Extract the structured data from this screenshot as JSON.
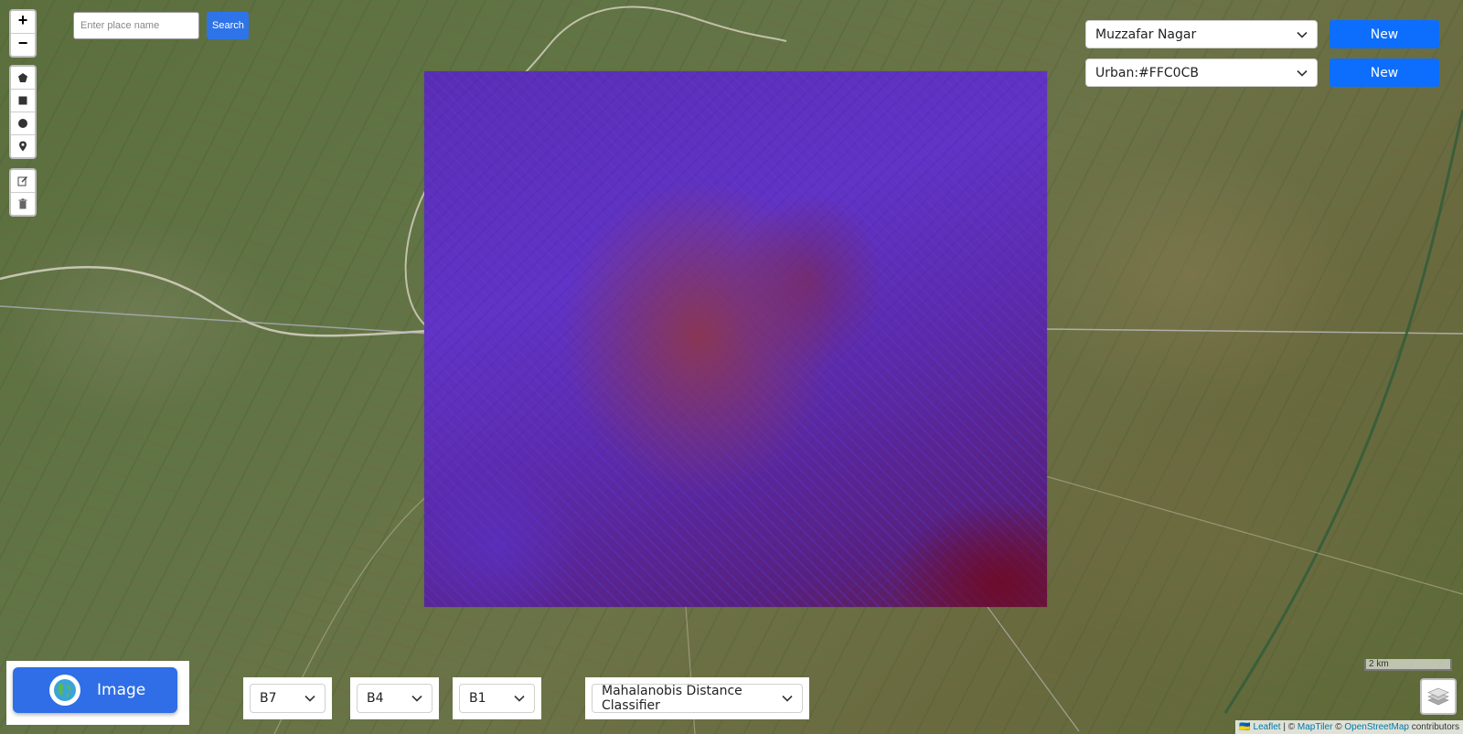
{
  "search": {
    "placeholder": "Enter place name",
    "button_label": "Search"
  },
  "zoom": {
    "in_label": "+",
    "out_label": "−"
  },
  "draw_tools": [
    "polygon-icon",
    "rectangle-icon",
    "circle-icon",
    "marker-icon"
  ],
  "edit_tools": [
    "edit-icon",
    "trash-icon"
  ],
  "top_right": {
    "region_select": {
      "value": "Muzzafar Nagar"
    },
    "region_new_label": "New",
    "class_select": {
      "value": "Urban:#FFC0CB"
    },
    "class_new_label": "New"
  },
  "bottom": {
    "image_button_label": "Image",
    "band_selects": [
      {
        "value": "B7"
      },
      {
        "value": "B4"
      },
      {
        "value": "B1"
      }
    ],
    "classifier_select": {
      "value": "Mahalanobis Distance Classifier"
    }
  },
  "scale": {
    "label": "2 km"
  },
  "attribution": {
    "flag": "🇺🇦",
    "leaflet": "Leaflet",
    "sep1": " | © ",
    "maptiler": "MapTiler",
    "sep2": " © ",
    "osm": "OpenStreetMap",
    "suffix": " contributors"
  },
  "colors": {
    "accent": "#0d6efd",
    "search_button": "#2e74e8",
    "image_button": "#2f6ee6"
  }
}
